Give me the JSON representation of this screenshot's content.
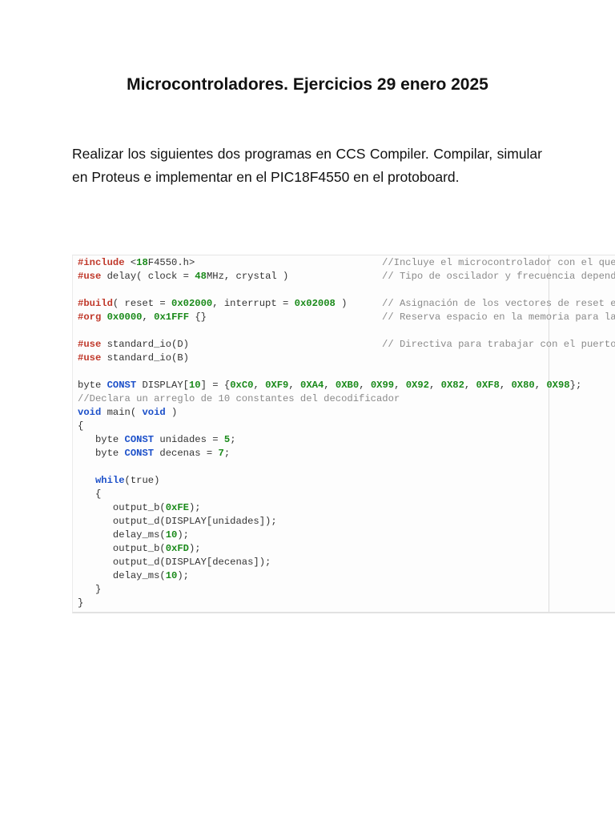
{
  "title": "Microcontroladores. Ejercicios 29 enero 2025",
  "intro": "Realizar los siguientes dos programas en CCS Compiler. Compilar, simular en Proteus e implementar en el PIC18F4550 en el protoboard.",
  "code": {
    "lines": [
      {
        "tokens": [
          [
            "pre",
            "#include"
          ],
          [
            "txt",
            " <"
          ],
          [
            "num",
            "18"
          ],
          [
            "txt",
            "F4550.h>"
          ]
        ],
        "comment": "//Incluye el microcontrolador con el que"
      },
      {
        "tokens": [
          [
            "pre",
            "#use"
          ],
          [
            "txt",
            " delay( clock = "
          ],
          [
            "num",
            "48"
          ],
          [
            "txt",
            "MHz, crystal )"
          ]
        ],
        "comment": "// Tipo de oscilador y frecuencia depend"
      },
      {
        "tokens": []
      },
      {
        "tokens": [
          [
            "pre",
            "#build"
          ],
          [
            "txt",
            "( reset = "
          ],
          [
            "num",
            "0x02000"
          ],
          [
            "txt",
            ", interrupt = "
          ],
          [
            "num",
            "0x02008"
          ],
          [
            "txt",
            " )"
          ]
        ],
        "comment": "// Asignación de los vectores de reset e"
      },
      {
        "tokens": [
          [
            "pre",
            "#org"
          ],
          [
            "txt",
            " "
          ],
          [
            "num",
            "0x0000"
          ],
          [
            "txt",
            ", "
          ],
          [
            "num",
            "0x1FFF"
          ],
          [
            "txt",
            " {}"
          ]
        ],
        "comment": "// Reserva espacio en la memoria para la"
      },
      {
        "tokens": []
      },
      {
        "tokens": [
          [
            "pre",
            "#use"
          ],
          [
            "txt",
            " standard_io(D)"
          ]
        ],
        "comment": "// Directiva para trabajar con el puerto"
      },
      {
        "tokens": [
          [
            "pre",
            "#use"
          ],
          [
            "txt",
            " standard_io(B)"
          ]
        ]
      },
      {
        "tokens": []
      },
      {
        "tokens": [
          [
            "txt",
            "byte "
          ],
          [
            "kw",
            "CONST"
          ],
          [
            "txt",
            " DISPLAY["
          ],
          [
            "num",
            "10"
          ],
          [
            "txt",
            "] = {"
          ],
          [
            "num",
            "0xC0"
          ],
          [
            "txt",
            ", "
          ],
          [
            "num",
            "0XF9"
          ],
          [
            "txt",
            ", "
          ],
          [
            "num",
            "0XA4"
          ],
          [
            "txt",
            ", "
          ],
          [
            "num",
            "0XB0"
          ],
          [
            "txt",
            ", "
          ],
          [
            "num",
            "0X99"
          ],
          [
            "txt",
            ", "
          ],
          [
            "num",
            "0X92"
          ],
          [
            "txt",
            ", "
          ],
          [
            "num",
            "0X82"
          ],
          [
            "txt",
            ", "
          ],
          [
            "num",
            "0XF8"
          ],
          [
            "txt",
            ", "
          ],
          [
            "num",
            "0X80"
          ],
          [
            "txt",
            ", "
          ],
          [
            "num",
            "0X98"
          ],
          [
            "txt",
            "};"
          ]
        ]
      },
      {
        "tokens": [
          [
            "com",
            "//Declara un arreglo de 10 constantes del decodificador"
          ]
        ]
      },
      {
        "tokens": [
          [
            "kw",
            "void"
          ],
          [
            "txt",
            " main( "
          ],
          [
            "kw",
            "void"
          ],
          [
            "txt",
            " )"
          ]
        ]
      },
      {
        "tokens": [
          [
            "txt",
            "{"
          ]
        ]
      },
      {
        "tokens": [
          [
            "txt",
            "   byte "
          ],
          [
            "kw",
            "CONST"
          ],
          [
            "txt",
            " unidades = "
          ],
          [
            "num",
            "5"
          ],
          [
            "txt",
            ";"
          ]
        ]
      },
      {
        "tokens": [
          [
            "txt",
            "   byte "
          ],
          [
            "kw",
            "CONST"
          ],
          [
            "txt",
            " decenas = "
          ],
          [
            "num",
            "7"
          ],
          [
            "txt",
            ";"
          ]
        ]
      },
      {
        "tokens": []
      },
      {
        "tokens": [
          [
            "txt",
            "   "
          ],
          [
            "kw",
            "while"
          ],
          [
            "txt",
            "(true)"
          ]
        ]
      },
      {
        "tokens": [
          [
            "txt",
            "   {"
          ]
        ]
      },
      {
        "tokens": [
          [
            "txt",
            "      output_b("
          ],
          [
            "num",
            "0xFE"
          ],
          [
            "txt",
            ");"
          ]
        ]
      },
      {
        "tokens": [
          [
            "txt",
            "      output_d(DISPLAY[unidades]);"
          ]
        ]
      },
      {
        "tokens": [
          [
            "txt",
            "      delay_ms("
          ],
          [
            "num",
            "10"
          ],
          [
            "txt",
            ");"
          ]
        ]
      },
      {
        "tokens": [
          [
            "txt",
            "      output_b("
          ],
          [
            "num",
            "0xFD"
          ],
          [
            "txt",
            ");"
          ]
        ]
      },
      {
        "tokens": [
          [
            "txt",
            "      output_d(DISPLAY[decenas]);"
          ]
        ]
      },
      {
        "tokens": [
          [
            "txt",
            "      delay_ms("
          ],
          [
            "num",
            "10"
          ],
          [
            "txt",
            ");"
          ]
        ]
      },
      {
        "tokens": [
          [
            "txt",
            "   }"
          ]
        ]
      },
      {
        "tokens": [
          [
            "txt",
            "}"
          ]
        ]
      }
    ]
  }
}
